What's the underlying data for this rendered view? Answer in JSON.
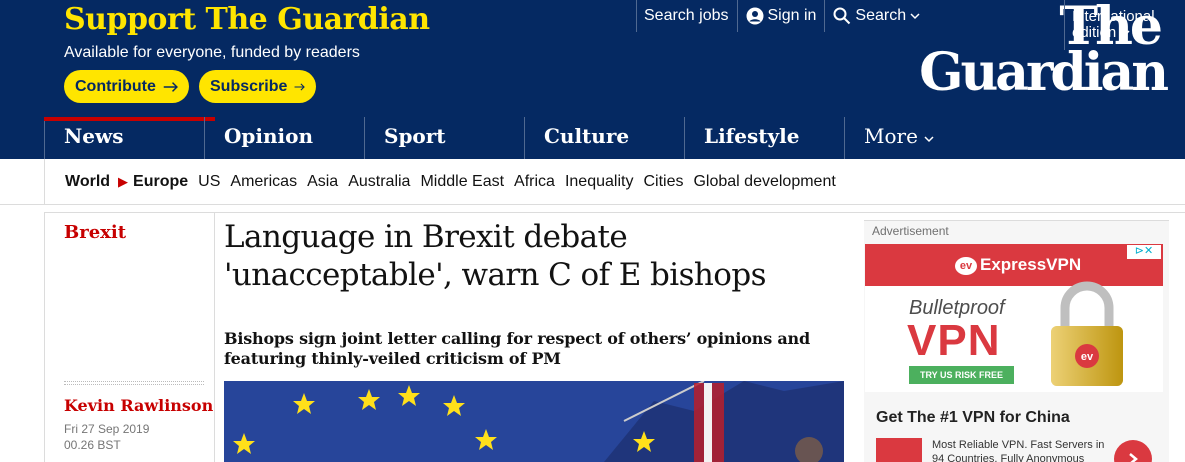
{
  "support": {
    "title": "Support The Guardian",
    "subtitle": "Available for everyone, funded by readers",
    "contribute_label": "Contribute",
    "subscribe_label": "Subscribe"
  },
  "top_links": {
    "search_jobs": "Search jobs",
    "sign_in": "Sign in",
    "search": "Search"
  },
  "edition": {
    "line1": "International",
    "line2": "edition"
  },
  "logo": {
    "line1": "The",
    "line2": "Guardian"
  },
  "nav": {
    "items": [
      {
        "label": "News"
      },
      {
        "label": "Opinion"
      },
      {
        "label": "Sport"
      },
      {
        "label": "Culture"
      },
      {
        "label": "Lifestyle"
      },
      {
        "label": "More"
      }
    ]
  },
  "subnav": {
    "items": [
      "World",
      "Europe",
      "US",
      "Americas",
      "Asia",
      "Australia",
      "Middle East",
      "Africa",
      "Inequality",
      "Cities",
      "Global development"
    ]
  },
  "article": {
    "section": "Brexit",
    "headline": "Language in Brexit debate 'unacceptable', warn C of E bishops",
    "standfirst": "Bishops sign joint letter calling for respect of others’ opinions and featuring thinly-veiled criticism of PM",
    "byline": "Kevin Rawlinson",
    "date": "Fri 27 Sep 2019",
    "time": "00.26 BST"
  },
  "ad": {
    "label": "Advertisement",
    "brand": "ExpressVPN",
    "bulletproof": "Bulletproof",
    "vpn": "VPN",
    "cta": "TRY US RISK FREE",
    "title": "Get The #1 VPN for China",
    "body": "Most Reliable VPN. Fast Servers in 94 Countries. Fully Anonymous"
  },
  "colors": {
    "brand_blue": "#052962",
    "support_yellow": "#ffe500",
    "news_red": "#c70000",
    "ad_red": "#da3940"
  }
}
